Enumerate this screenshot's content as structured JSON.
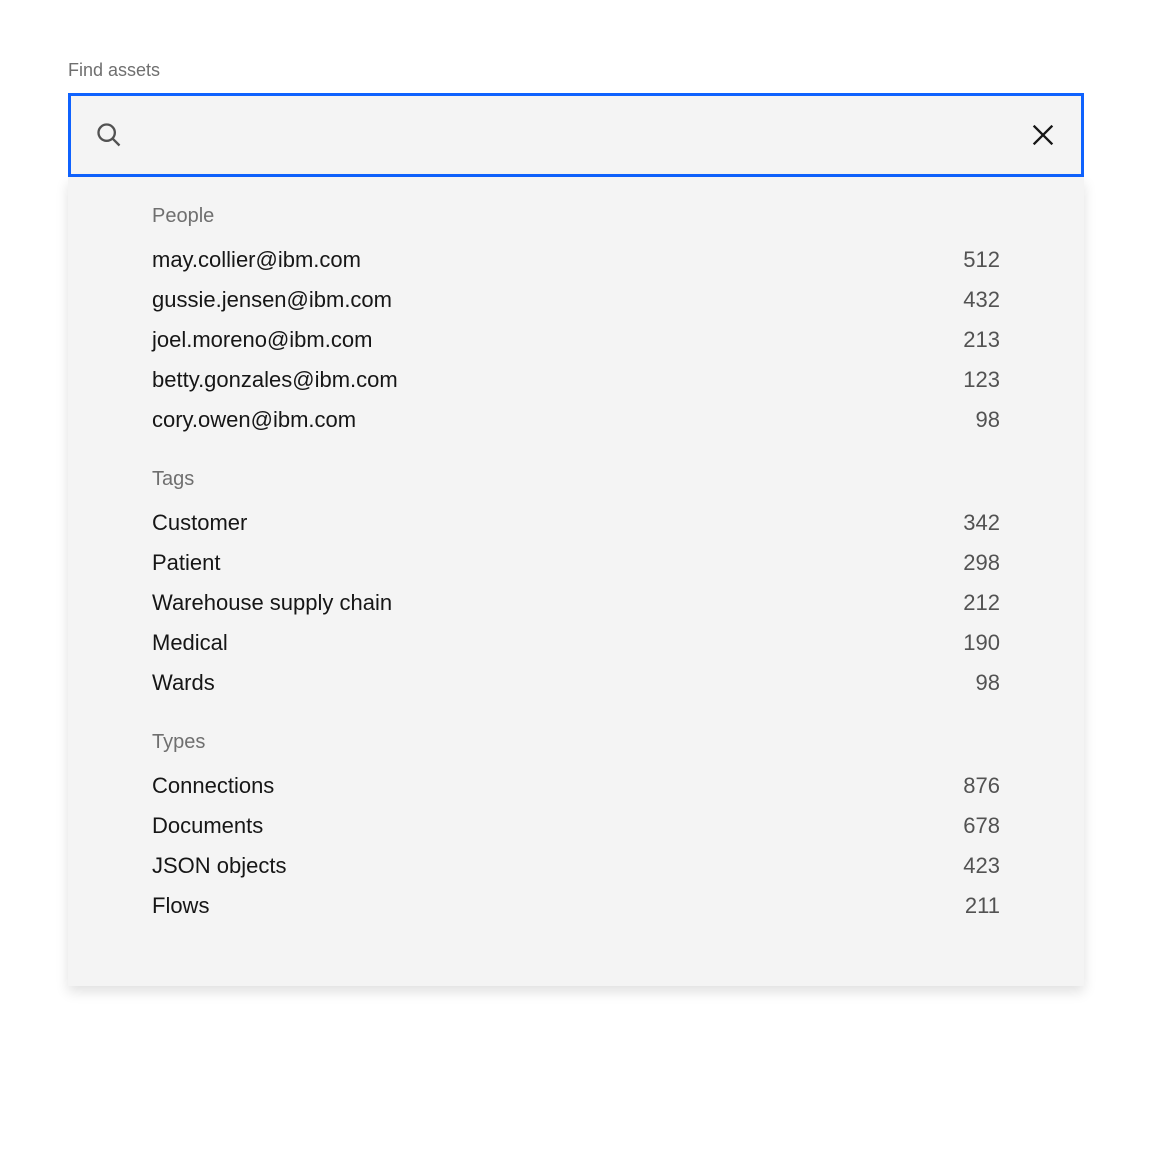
{
  "field_label": "Find assets",
  "search": {
    "value": "",
    "placeholder": ""
  },
  "sections": [
    {
      "header": "People",
      "items": [
        {
          "label": "may.collier@ibm.com",
          "count": "512"
        },
        {
          "label": "gussie.jensen@ibm.com",
          "count": "432"
        },
        {
          "label": "joel.moreno@ibm.com",
          "count": "213"
        },
        {
          "label": "betty.gonzales@ibm.com",
          "count": "123"
        },
        {
          "label": "cory.owen@ibm.com",
          "count": "98"
        }
      ]
    },
    {
      "header": "Tags",
      "items": [
        {
          "label": "Customer",
          "count": "342"
        },
        {
          "label": "Patient",
          "count": "298"
        },
        {
          "label": "Warehouse supply chain",
          "count": "212"
        },
        {
          "label": "Medical",
          "count": "190"
        },
        {
          "label": "Wards",
          "count": "98"
        }
      ]
    },
    {
      "header": "Types",
      "items": [
        {
          "label": "Connections",
          "count": "876"
        },
        {
          "label": "Documents",
          "count": "678"
        },
        {
          "label": "JSON objects",
          "count": "423"
        },
        {
          "label": "Flows",
          "count": "211"
        }
      ]
    }
  ]
}
